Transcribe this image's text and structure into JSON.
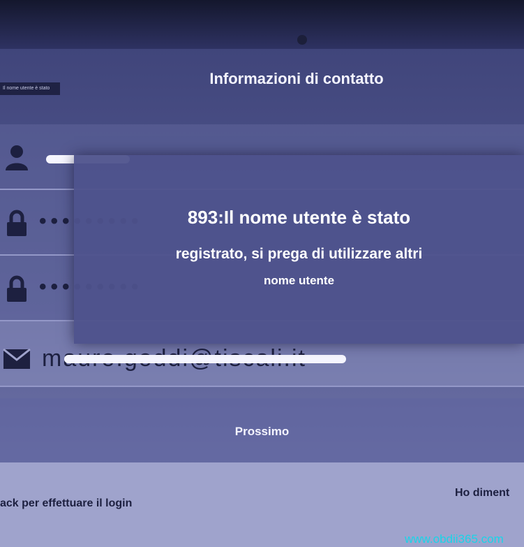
{
  "header": {
    "title": "Informazioni di contatto",
    "status_label": "Il nome utente è stato"
  },
  "form": {
    "email_value": "mauro.goddi@tiscali.it"
  },
  "dialog": {
    "line1": "893:Il nome utente è stato",
    "line2": "registrato, si prega di utilizzare altri",
    "line3": "nome utente"
  },
  "buttons": {
    "next_label": "Prossimo"
  },
  "footer": {
    "login_link": "ack per effettuare il login",
    "forgot_link": "Ho diment"
  },
  "watermark": "www.obdii365.com",
  "colors": {
    "background": "#4a4f86",
    "toast": "#4e528c",
    "watermark": "#19d4e8"
  },
  "icons": [
    "user-icon",
    "lock-icon",
    "lock-icon",
    "mail-icon"
  ]
}
